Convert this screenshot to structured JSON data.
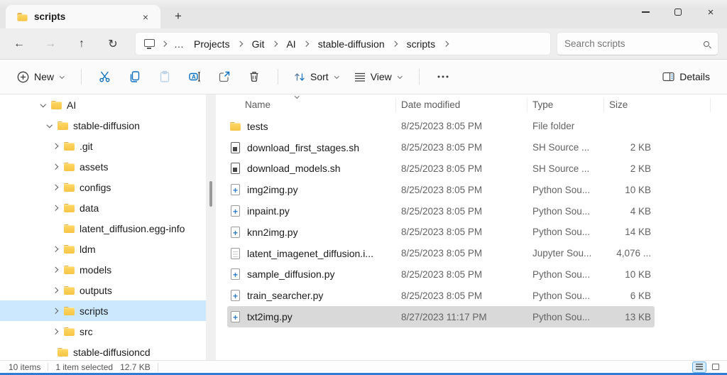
{
  "colors": {
    "accent_blue": "#0b6fc2",
    "sidebar_selection": "#cce8ff",
    "row_selection": "#d9d9d9",
    "folder_yellow": "#f6c445",
    "bottom_edge_blue": "#2e7cd6"
  },
  "titlebar": {
    "tab_title": "scripts",
    "close_tab": "×",
    "new_tab": "+",
    "close_window": "×"
  },
  "nav": {
    "ellipsis": "…",
    "breadcrumb": [
      "Projects",
      "Git",
      "AI",
      "stable-diffusion",
      "scripts"
    ],
    "search_placeholder": "Search scripts"
  },
  "toolbar": {
    "new_label": "New",
    "sort_label": "Sort",
    "view_label": "View",
    "details_label": "Details"
  },
  "list": {
    "columns": [
      "Name",
      "Date modified",
      "Type",
      "Size"
    ],
    "rows": [
      {
        "name": "tests",
        "icon": "folder",
        "date": "8/25/2023 8:05 PM",
        "type": "File folder",
        "size": "",
        "selected": false
      },
      {
        "name": "download_first_stages.sh",
        "icon": "sh",
        "date": "8/25/2023 8:05 PM",
        "type": "SH Source ...",
        "size": "2 KB",
        "selected": false
      },
      {
        "name": "download_models.sh",
        "icon": "sh",
        "date": "8/25/2023 8:05 PM",
        "type": "SH Source ...",
        "size": "2 KB",
        "selected": false
      },
      {
        "name": "img2img.py",
        "icon": "py",
        "date": "8/25/2023 8:05 PM",
        "type": "Python Sou...",
        "size": "10 KB",
        "selected": false
      },
      {
        "name": "inpaint.py",
        "icon": "py",
        "date": "8/25/2023 8:05 PM",
        "type": "Python Sou...",
        "size": "4 KB",
        "selected": false
      },
      {
        "name": "knn2img.py",
        "icon": "py",
        "date": "8/25/2023 8:05 PM",
        "type": "Python Sou...",
        "size": "14 KB",
        "selected": false
      },
      {
        "name": "latent_imagenet_diffusion.i...",
        "icon": "ipynb",
        "date": "8/25/2023 8:05 PM",
        "type": "Jupyter Sou...",
        "size": "4,076 ...",
        "selected": false
      },
      {
        "name": "sample_diffusion.py",
        "icon": "py",
        "date": "8/25/2023 8:05 PM",
        "type": "Python Sou...",
        "size": "10 KB",
        "selected": false
      },
      {
        "name": "train_searcher.py",
        "icon": "py",
        "date": "8/25/2023 8:05 PM",
        "type": "Python Sou...",
        "size": "6 KB",
        "selected": false
      },
      {
        "name": "txt2img.py",
        "icon": "py",
        "date": "8/27/2023 11:17 PM",
        "type": "Python Sou...",
        "size": "13 KB",
        "selected": true
      }
    ]
  },
  "sidebar": {
    "items": [
      {
        "label": "AI",
        "level": 0,
        "chevron": "expanded",
        "selected": false
      },
      {
        "label": "stable-diffusion",
        "level": 1,
        "chevron": "expanded",
        "selected": false
      },
      {
        "label": ".git",
        "level": 2,
        "chevron": "collapsed",
        "selected": false
      },
      {
        "label": "assets",
        "level": 2,
        "chevron": "collapsed",
        "selected": false
      },
      {
        "label": "configs",
        "level": 2,
        "chevron": "collapsed",
        "selected": false
      },
      {
        "label": "data",
        "level": 2,
        "chevron": "collapsed",
        "selected": false
      },
      {
        "label": "latent_diffusion.egg-info",
        "level": 2,
        "chevron": "none",
        "selected": false
      },
      {
        "label": "ldm",
        "level": 2,
        "chevron": "collapsed",
        "selected": false
      },
      {
        "label": "models",
        "level": 2,
        "chevron": "collapsed",
        "selected": false
      },
      {
        "label": "outputs",
        "level": 2,
        "chevron": "collapsed",
        "selected": false
      },
      {
        "label": "scripts",
        "level": 2,
        "chevron": "collapsed",
        "selected": true
      },
      {
        "label": "src",
        "level": 2,
        "chevron": "collapsed",
        "selected": false
      },
      {
        "label": "stable-diffusioncd",
        "level": 1,
        "chevron": "none",
        "selected": false
      }
    ]
  },
  "status": {
    "items_count": "10 items",
    "selection": "1 item selected",
    "selection_size": "12.7 KB"
  }
}
